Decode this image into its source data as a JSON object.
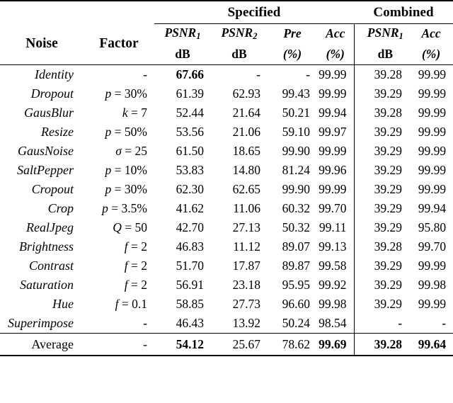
{
  "table": {
    "group_headers": {
      "specified": "Specified",
      "combined": "Combined"
    },
    "columns": {
      "noise": "Noise",
      "factor": "Factor",
      "spec_psnr1_sym": "PSNR",
      "spec_psnr1_subscript": "1",
      "spec_psnr1_unit": "dB",
      "spec_psnr2_sym": "PSNR",
      "spec_psnr2_subscript": "2",
      "spec_psnr2_unit": "dB",
      "spec_pre_sym": "Pre",
      "spec_pre_unit": "(%)",
      "spec_acc_sym": "Acc",
      "spec_acc_unit": "(%)",
      "comb_psnr1_sym": "PSNR",
      "comb_psnr1_subscript": "1",
      "comb_psnr1_unit": "dB",
      "comb_acc_sym": "Acc",
      "comb_acc_unit": "(%)"
    },
    "rows": [
      {
        "noise": "Identity",
        "factor": "-",
        "spec_psnr1": "67.66",
        "spec_psnr1_bold": true,
        "spec_psnr2": "-",
        "spec_pre": "-",
        "spec_acc": "99.99",
        "comb_psnr1": "39.28",
        "comb_acc": "99.99"
      },
      {
        "noise": "Dropout",
        "factor": "p = 30%",
        "factor_sym": "p",
        "factor_rest": " = 30%",
        "spec_psnr1": "61.39",
        "spec_psnr2": "62.93",
        "spec_pre": "99.43",
        "spec_acc": "99.99",
        "comb_psnr1": "39.29",
        "comb_acc": "99.99"
      },
      {
        "noise": "GausBlur",
        "factor": "k = 7",
        "factor_sym": "k",
        "factor_rest": " = 7",
        "spec_psnr1": "52.44",
        "spec_psnr2": "21.64",
        "spec_pre": "50.21",
        "spec_acc": "99.94",
        "comb_psnr1": "39.28",
        "comb_acc": "99.99"
      },
      {
        "noise": "Resize",
        "factor": "p = 50%",
        "factor_sym": "p",
        "factor_rest": " = 50%",
        "spec_psnr1": "53.56",
        "spec_psnr2": "21.06",
        "spec_pre": "59.10",
        "spec_acc": "99.97",
        "comb_psnr1": "39.29",
        "comb_acc": "99.99"
      },
      {
        "noise": "GausNoise",
        "factor": "σ = 25",
        "factor_sym": "σ",
        "factor_rest": " = 25",
        "spec_psnr1": "61.50",
        "spec_psnr2": "18.65",
        "spec_pre": "99.90",
        "spec_acc": "99.99",
        "comb_psnr1": "39.29",
        "comb_acc": "99.99"
      },
      {
        "noise": "SaltPepper",
        "factor": "p = 10%",
        "factor_sym": "p",
        "factor_rest": " = 10%",
        "spec_psnr1": "53.83",
        "spec_psnr2": "14.80",
        "spec_pre": "81.24",
        "spec_acc": "99.96",
        "comb_psnr1": "39.29",
        "comb_acc": "99.99"
      },
      {
        "noise": "Cropout",
        "factor": "p = 30%",
        "factor_sym": "p",
        "factor_rest": " = 30%",
        "spec_psnr1": "62.30",
        "spec_psnr2": "62.65",
        "spec_pre": "99.90",
        "spec_acc": "99.99",
        "comb_psnr1": "39.29",
        "comb_acc": "99.99"
      },
      {
        "noise": "Crop",
        "factor": "p = 3.5%",
        "factor_sym": "p",
        "factor_rest": " = 3.5%",
        "spec_psnr1": "41.62",
        "spec_psnr2": "11.06",
        "spec_pre": "60.32",
        "spec_acc": "99.70",
        "comb_psnr1": "39.29",
        "comb_acc": "99.94"
      },
      {
        "noise": "RealJpeg",
        "factor": "Q = 50",
        "factor_sym": "Q",
        "factor_rest": " = 50",
        "spec_psnr1": "42.70",
        "spec_psnr2": "27.13",
        "spec_pre": "50.32",
        "spec_acc": "99.11",
        "comb_psnr1": "39.29",
        "comb_acc": "95.80"
      },
      {
        "noise": "Brightness",
        "factor": "f = 2",
        "factor_sym": "f",
        "factor_rest": " = 2",
        "spec_psnr1": "46.83",
        "spec_psnr2": "11.12",
        "spec_pre": "89.07",
        "spec_acc": "99.13",
        "comb_psnr1": "39.28",
        "comb_acc": "99.70"
      },
      {
        "noise": "Contrast",
        "factor": "f = 2",
        "factor_sym": "f",
        "factor_rest": " = 2",
        "spec_psnr1": "51.70",
        "spec_psnr2": "17.87",
        "spec_pre": "89.87",
        "spec_acc": "99.58",
        "comb_psnr1": "39.29",
        "comb_acc": "99.99"
      },
      {
        "noise": "Saturation",
        "factor": "f = 2",
        "factor_sym": "f",
        "factor_rest": " = 2",
        "spec_psnr1": "56.91",
        "spec_psnr2": "23.18",
        "spec_pre": "95.95",
        "spec_acc": "99.92",
        "comb_psnr1": "39.29",
        "comb_acc": "99.98"
      },
      {
        "noise": "Hue",
        "factor": "f = 0.1",
        "factor_sym": "f",
        "factor_rest": " = 0.1",
        "spec_psnr1": "58.85",
        "spec_psnr2": "27.73",
        "spec_pre": "96.60",
        "spec_acc": "99.98",
        "comb_psnr1": "39.29",
        "comb_acc": "99.99"
      },
      {
        "noise": "Superimpose",
        "factor": "-",
        "spec_psnr1": "46.43",
        "spec_psnr2": "13.92",
        "spec_pre": "50.24",
        "spec_acc": "98.54",
        "comb_psnr1": "-",
        "comb_acc": "-"
      }
    ],
    "average_row": {
      "noise": "Average",
      "factor": "-",
      "spec_psnr1": "54.12",
      "spec_psnr1_bold": true,
      "spec_psnr2": "25.67",
      "spec_pre": "78.62",
      "spec_acc": "99.69",
      "spec_acc_bold": true,
      "comb_psnr1": "39.28",
      "comb_psnr1_bold": true,
      "comb_acc": "99.64",
      "comb_acc_bold": true
    }
  }
}
